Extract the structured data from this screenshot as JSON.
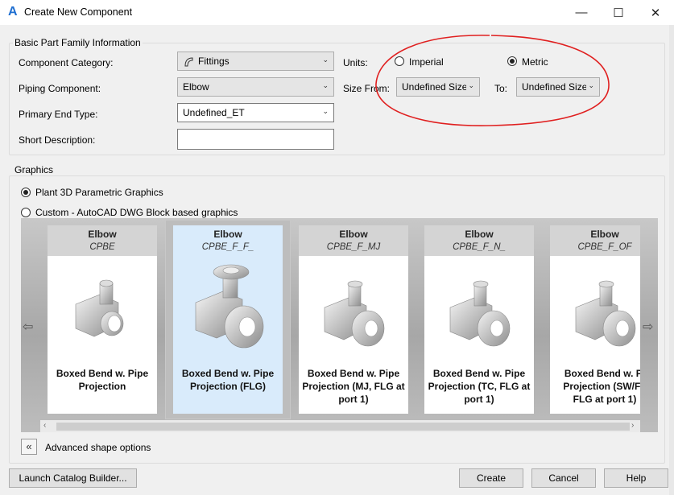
{
  "window": {
    "title": "Create New Component"
  },
  "basic": {
    "legend": "Basic Part Family Information",
    "category_label": "Component Category:",
    "category_value": "Fittings",
    "piping_label": "Piping Component:",
    "piping_value": "Elbow",
    "endtype_label": "Primary End Type:",
    "endtype_value": "Undefined_ET",
    "shortdesc_label": "Short Description:",
    "shortdesc_value": "",
    "units_label": "Units:",
    "units_imperial": "Imperial",
    "units_metric": "Metric",
    "units_selected": "Metric",
    "sizefrom_label": "Size From:",
    "sizefrom_value": "Undefined Size",
    "to_label": "To:",
    "to_value": "Undefined Size"
  },
  "graphics": {
    "legend": "Graphics",
    "option_parametric": "Plant 3D Parametric Graphics",
    "option_custom": "Custom - AutoCAD DWG Block based graphics",
    "selected": "Plant 3D Parametric Graphics",
    "cards": [
      {
        "title": "Elbow",
        "code": "CPBE",
        "desc1": "Boxed Bend w. Pipe",
        "desc2": "Projection",
        "desc3": ""
      },
      {
        "title": "Elbow",
        "code": "CPBE_F_F_",
        "desc1": "Boxed Bend w. Pipe",
        "desc2": "Projection (FLG)",
        "desc3": ""
      },
      {
        "title": "Elbow",
        "code": "CPBE_F_MJ",
        "desc1": "Boxed Bend w. Pipe",
        "desc2": "Projection (MJ, FLG at",
        "desc3": "port 1)"
      },
      {
        "title": "Elbow",
        "code": "CPBE_F_N_",
        "desc1": "Boxed Bend w. Pipe",
        "desc2": "Projection (TC, FLG at",
        "desc3": "port 1)"
      },
      {
        "title": "Elbow",
        "code": "CPBE_F_OF",
        "desc1": "Boxed Bend w. Pi",
        "desc2": "Projection (SW/FF",
        "desc3": "FLG at port 1)"
      }
    ],
    "selected_card": "CPBE_F_F_",
    "advanced_label": "Advanced shape options"
  },
  "buttons": {
    "launch": "Launch Catalog Builder...",
    "create": "Create",
    "cancel": "Cancel",
    "help": "Help"
  },
  "colors": {
    "accent": "#1f6fd1",
    "annotation": "#e02020",
    "selected_card": "#d9ebfb"
  }
}
